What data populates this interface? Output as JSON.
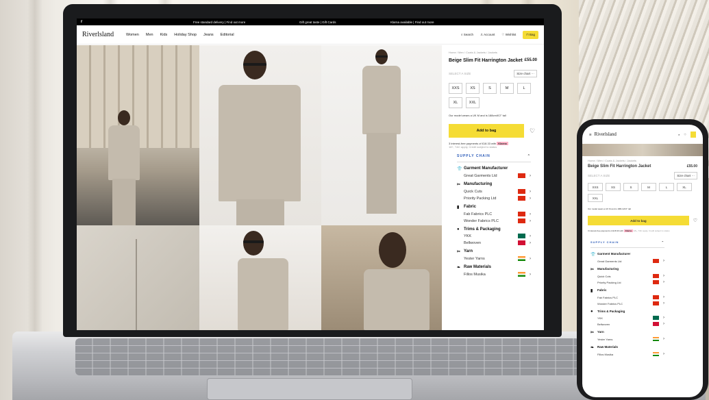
{
  "announcement": {
    "logo": "r",
    "t1": "Free standard delivery | Find out more",
    "t2": "Gift great taste | Gift Cards",
    "t3": "Klarna available | Find out more"
  },
  "nav": {
    "brand": "Riverlsland",
    "menu": [
      "Women",
      "Men",
      "Kids",
      "Holiday Shop",
      "Jeans",
      "Editorial"
    ],
    "search": "Search",
    "account": "Account",
    "wishlist": "Wishlist",
    "bag": "Bag"
  },
  "product": {
    "breadcrumb": "Home / Men / Coats & Jackets / Jackets",
    "title": "Beige Slim Fit Harrington Jacket",
    "price": "£55.00",
    "select_size": "SELECT A SIZE",
    "size_chart": "Size chart ···",
    "sizes": [
      "XXS",
      "XS",
      "S",
      "M",
      "L",
      "XL",
      "XXL"
    ],
    "model_note": "Our model wears a UK M and is 188cm/6'2\" tall",
    "add_to_bag": "Add to bag",
    "klarna_text": "3 interest-free payments of £18.33 with",
    "klarna_badge": "Klarna",
    "klarna_note": "18+, T&C apply, Credit subject to status"
  },
  "supply_chain": {
    "heading": "SUPPLY CHAIN",
    "groups": [
      {
        "icon": "shirt-icon",
        "glyph": "👕",
        "title": "Garment Manufacturer",
        "items": [
          {
            "name": "Great Garments Ltd",
            "flag": "cn"
          }
        ]
      },
      {
        "icon": "scissors-icon",
        "glyph": "✂",
        "title": "Manufacturing",
        "items": [
          {
            "name": "Quick Cuts",
            "flag": "cn"
          },
          {
            "name": "Priority Packing Ltd",
            "flag": "cn"
          }
        ]
      },
      {
        "icon": "fabric-icon",
        "glyph": "▮",
        "title": "Fabric",
        "items": [
          {
            "name": "Fab Fabrics PLC",
            "flag": "cn"
          },
          {
            "name": "Wonder Fabrics PLC",
            "flag": "cn"
          }
        ]
      },
      {
        "icon": "thread-icon",
        "glyph": "●",
        "title": "Trims & Packaging",
        "items": [
          {
            "name": "YKK",
            "flag": "bd"
          },
          {
            "name": "Bellwoven",
            "flag": "lk"
          }
        ]
      },
      {
        "icon": "yarn-icon",
        "glyph": "✂",
        "title": "Yarn",
        "items": [
          {
            "name": "Yester Yarns",
            "flag": "in"
          }
        ]
      },
      {
        "icon": "cotton-icon",
        "glyph": "❧",
        "title": "Raw Materials",
        "items": [
          {
            "name": "Fillos Musika",
            "flag": "in"
          }
        ]
      }
    ]
  },
  "phone": {
    "brand": "Riverlsland",
    "title": "Beige Slim Fit Harrington Jacket",
    "price": "£55.00"
  }
}
